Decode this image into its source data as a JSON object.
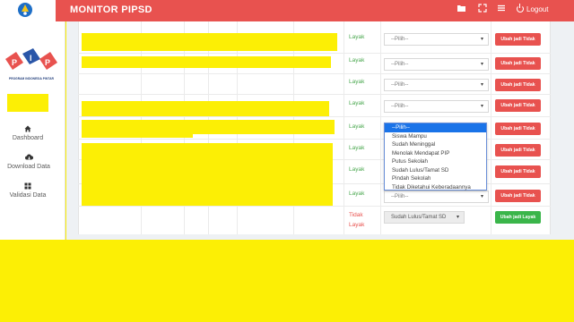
{
  "header": {
    "title": "MONITOR PIPSD",
    "logout_label": "Logout",
    "icons": [
      "folder-icon",
      "expand-icon",
      "menu-icon",
      "power-icon"
    ]
  },
  "sidebar": {
    "logo_caption": "PROGRAM INDONESIA PINTAR",
    "items": [
      {
        "label": "Dashboard",
        "icon": "home-icon"
      },
      {
        "label": "Download Data",
        "icon": "cloud-download-icon"
      },
      {
        "label": "Validasi Data",
        "icon": "grid-icon"
      }
    ]
  },
  "table": {
    "rows": [
      {
        "status": "Layak",
        "select_value": "--Pilih--",
        "button_label": "Ubah jadi Tidak"
      },
      {
        "status": "Layak",
        "select_value": "--Pilih--",
        "button_label": "Ubah jadi Tidak"
      },
      {
        "status": "Layak",
        "select_value": "--Pilih--",
        "button_label": "Ubah jadi Tidak"
      },
      {
        "status": "Layak",
        "select_value": "--Pilih--",
        "button_label": "Ubah jadi Tidak"
      },
      {
        "status": "Layak",
        "select_value": "--Pilih--",
        "button_label": "Ubah jadi Tidak"
      },
      {
        "status": "Layak",
        "select_value": "",
        "button_label": "Ubah jadi Tidak"
      },
      {
        "status": "Layak",
        "select_value": "",
        "button_label": "Ubah jadi Tidak"
      },
      {
        "status": "Layak",
        "select_value": "--Pilih--",
        "button_label": "Ubah jadi Tidak"
      },
      {
        "status": "Tidak Layak",
        "select_value": "Sudah Lulus/Tamat SD",
        "button_label": "Ubah jadi Layak"
      }
    ],
    "dropdown_options": [
      "--Pilih--",
      "Siswa Mampu",
      "Sudah Meninggal",
      "Menolak Mendapat PIP",
      "Putus Sekolah",
      "Sudah Lulus/Tamat SD",
      "Pindah Sekolah",
      "Tidak Diketahui Keberadaannya"
    ]
  },
  "colors": {
    "header": "#e8524f",
    "danger_button": "#e8524f",
    "success_button": "#3ab54a",
    "layak_text": "#4aa84f",
    "redaction": "#fcef05",
    "dropdown_selected": "#1a73e8"
  }
}
